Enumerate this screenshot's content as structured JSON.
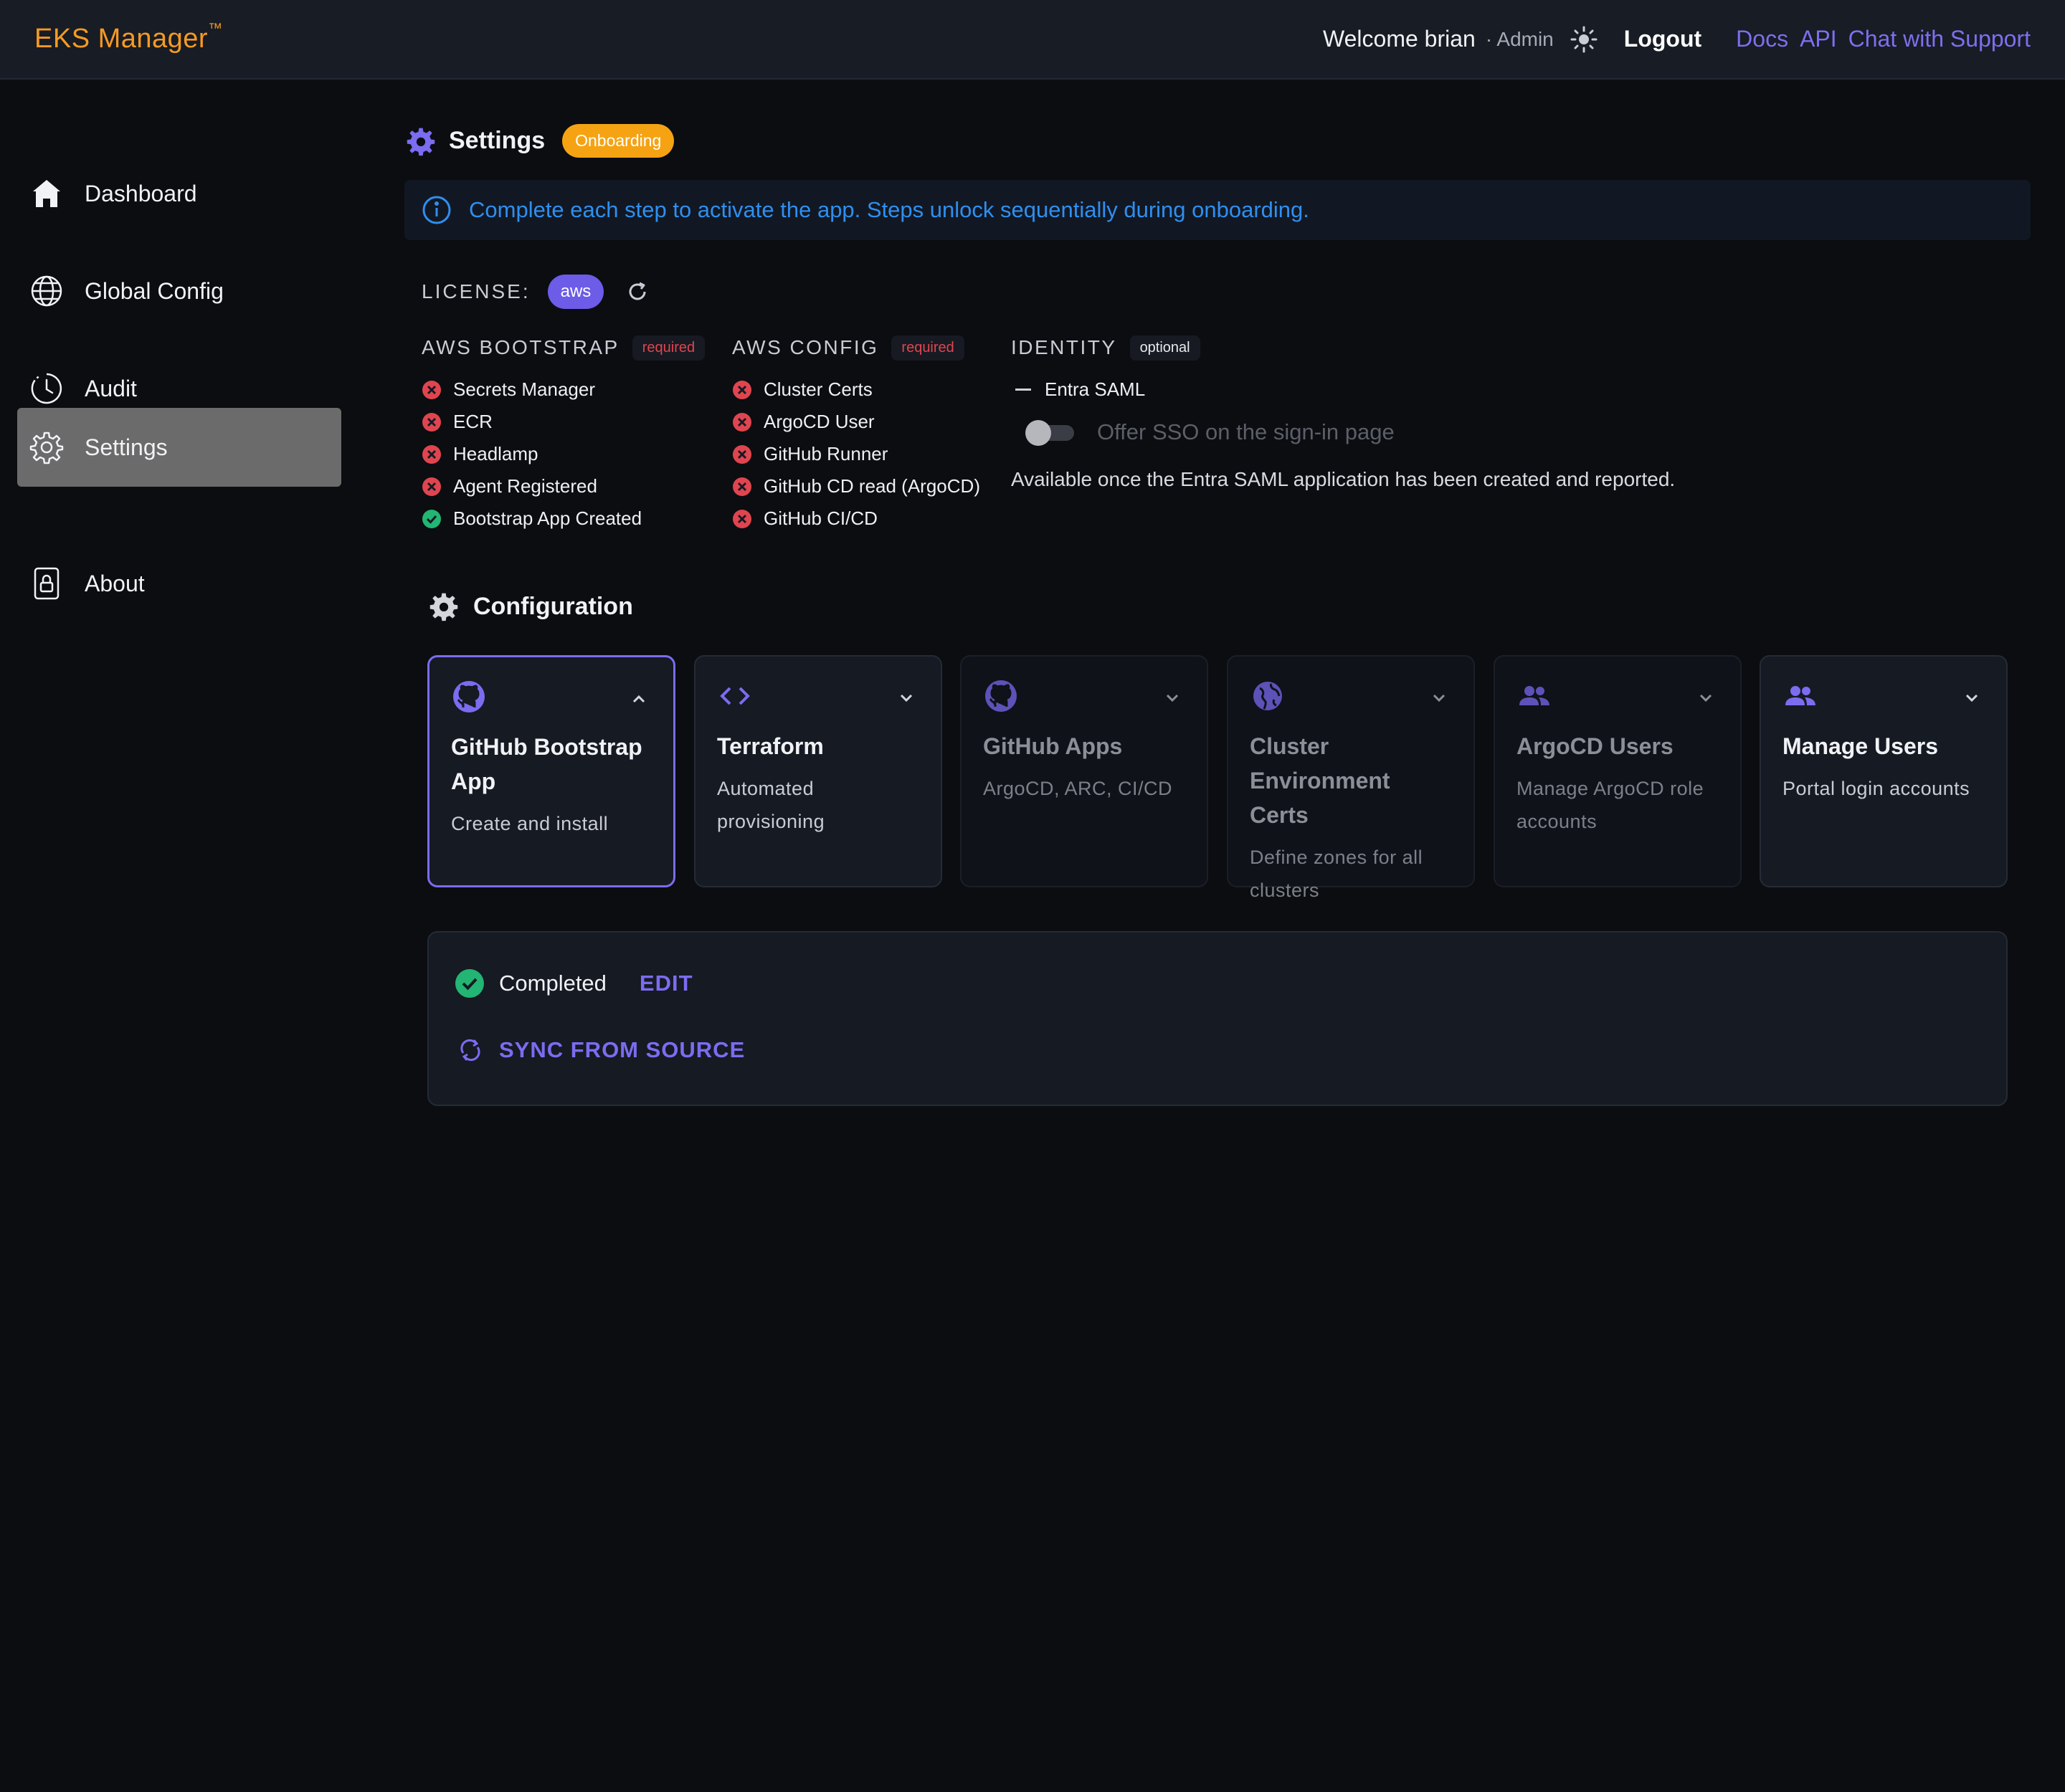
{
  "header": {
    "brand": "EKS Manager",
    "brand_tm": "™",
    "welcome": "Welcome brian",
    "role": "· Admin",
    "logout": "Logout",
    "links": [
      "Docs",
      "API",
      "Chat with Support"
    ],
    "link_color": "#7b70f0",
    "brand_color": "#f59a23"
  },
  "sidebar": {
    "items": [
      {
        "label": "Dashboard",
        "icon": "home-icon"
      },
      {
        "label": "Global Config",
        "icon": "globe-icon"
      },
      {
        "label": "Audit",
        "icon": "clock-icon"
      },
      {
        "label": "Settings",
        "icon": "gear-icon",
        "active": true
      },
      {
        "label": "About",
        "icon": "lock-icon"
      }
    ]
  },
  "page": {
    "title": "Settings",
    "badge": "Onboarding",
    "info": "Complete each step to activate the app. Steps unlock sequentially during onboarding."
  },
  "license": {
    "label": "LICENSE:",
    "value": "aws"
  },
  "requirements": [
    {
      "title": "AWS BOOTSTRAP",
      "tag": "required",
      "items": [
        {
          "label": "Secrets Manager",
          "status": "error"
        },
        {
          "label": "ECR",
          "status": "error"
        },
        {
          "label": "Headlamp",
          "status": "error"
        },
        {
          "label": "Agent Registered",
          "status": "error"
        },
        {
          "label": "Bootstrap App Created",
          "status": "ok"
        }
      ]
    },
    {
      "title": "AWS CONFIG",
      "tag": "required",
      "items": [
        {
          "label": "Cluster Certs",
          "status": "error"
        },
        {
          "label": "ArgoCD User",
          "status": "error"
        },
        {
          "label": "GitHub Runner",
          "status": "error"
        },
        {
          "label": "GitHub CD read (ArgoCD)",
          "status": "error"
        },
        {
          "label": "GitHub CI/CD",
          "status": "error"
        }
      ]
    },
    {
      "title": "IDENTITY",
      "tag": "optional",
      "items": [
        {
          "label": "Entra SAML",
          "status": "none"
        }
      ],
      "sso_label": "Offer SSO on the sign-in page",
      "sso_enabled": false,
      "note": "Available once the Entra SAML application has been created and reported."
    }
  ],
  "configuration": {
    "title": "Configuration",
    "cards": [
      {
        "title": "GitHub Bootstrap App",
        "subtitle": "Create and install",
        "icon": "github-icon",
        "expanded": true
      },
      {
        "title": "Terraform",
        "subtitle": "Automated provisioning",
        "icon": "code-icon"
      },
      {
        "title": "GitHub Apps",
        "subtitle": "ArgoCD, ARC, CI/CD",
        "icon": "github-icon"
      },
      {
        "title": "Cluster Environment Certs",
        "subtitle": "Define zones for all clusters",
        "icon": "globe-icon"
      },
      {
        "title": "ArgoCD Users",
        "subtitle": "Manage ArgoCD role accounts",
        "icon": "users-icon"
      },
      {
        "title": "Manage Users",
        "subtitle": "Portal login accounts",
        "icon": "users-icon"
      }
    ]
  },
  "status": {
    "label": "Completed",
    "edit": "EDIT",
    "sync": "SYNC FROM SOURCE"
  },
  "colors": {
    "accent": "#7b6cf0",
    "error": "#e0454f",
    "success": "#22b573",
    "info": "#2f8ff0",
    "warning": "#f5a313"
  }
}
